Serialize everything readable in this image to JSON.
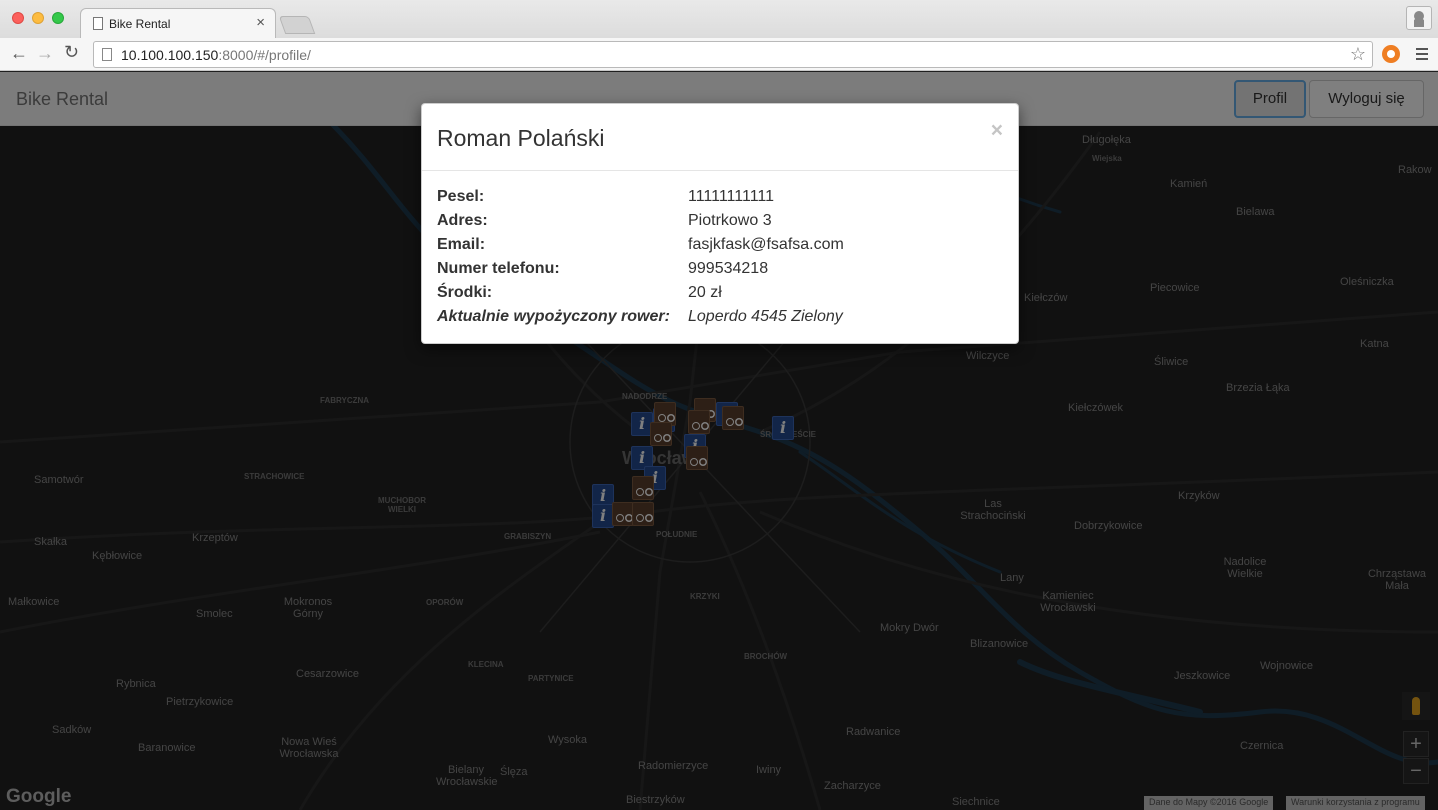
{
  "browser": {
    "tab_title": "Bike Rental",
    "tab_close": "×",
    "url_host": "10.100.100.150",
    "url_path": ":8000/#/profile/",
    "star": "☆"
  },
  "app": {
    "brand": "Bike Rental",
    "profile_button": "Profil",
    "logout_button": "Wyloguj się"
  },
  "map": {
    "labels": [
      "Długołęka",
      "Wiejska",
      "Kamień",
      "Rakow",
      "Bielawa",
      "Krzyżanów",
      "Piecowice",
      "Oleśniczka",
      "Kiełczów",
      "Wilczyce",
      "Katna",
      "Śliwice",
      "Brzezia Łąka",
      "Kiełczówek",
      "Krzyków",
      "Dobrzykowice",
      "Las Strachociński",
      "Nadolice Wielkie",
      "Chrząstawa Mała",
      "Lany",
      "Kamieniec Wrocławski",
      "Mokry Dwór",
      "Blizanowice",
      "Wojnowice",
      "Jeszkowice",
      "Radwanice",
      "Czernica",
      "Iwiny",
      "Zacharzyce",
      "Radomierzyce",
      "Biestrzyków",
      "Siechnice",
      "Bielany Wrocławskie",
      "Ślęza",
      "Wysoka",
      "Nowa Wieś Wrocławska",
      "Baranowice",
      "Sadków",
      "Pietrzykowice",
      "Rybnica",
      "Cesarzowice",
      "Smolec",
      "Mokronos Górny",
      "Małkowice",
      "Skałka",
      "Kębłowice",
      "Krzeptów",
      "Samotwór",
      "Wrocław"
    ],
    "small_labels": [
      "NADODRZE",
      "FABRYCZNA",
      "STRACHOWICE",
      "MUCHOBOR WIELKI",
      "GRABISZYN",
      "POŁUDNIE",
      "KRZYKI",
      "OPORÓW",
      "KLECINA",
      "PARTYNICE",
      "BROCHÓW",
      "ŚRÓDMIEŚCIE"
    ],
    "google": "Google",
    "attribution_data": "Dane do Mapy ©2016 Google",
    "attribution_terms": "Warunki korzystania z programu",
    "zoom_in": "+",
    "zoom_out": "−"
  },
  "modal": {
    "title": "Roman Polański",
    "close": "×",
    "fields": [
      {
        "label": "Pesel:",
        "value": "11111111111"
      },
      {
        "label": "Adres:",
        "value": "Piotrkowo 3"
      },
      {
        "label": "Email:",
        "value": "fasjkfask@fsafsa.com"
      },
      {
        "label": "Numer telefonu:",
        "value": "999534218"
      },
      {
        "label": "Środki:",
        "value": "20 zł"
      },
      {
        "label": "Aktualnie wypożyczony rower:",
        "value": "Loperdo 4545 Zielony"
      }
    ]
  },
  "colors": {
    "map_bg": "#222222",
    "water": "#1e3a4f",
    "info_pin": "#244a91",
    "bike_pin": "#5a3e2c",
    "focus_ring": "#66afe9"
  }
}
